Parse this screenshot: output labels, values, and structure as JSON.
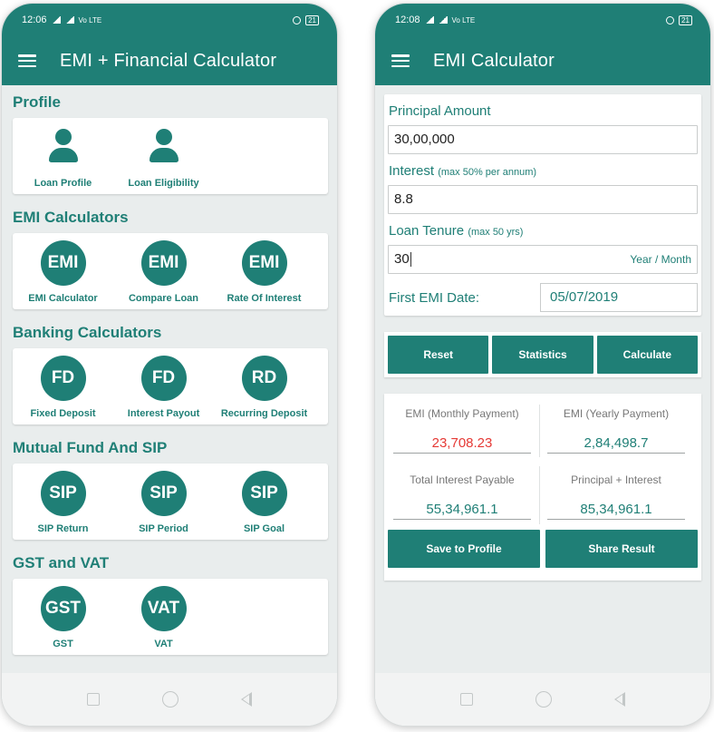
{
  "left": {
    "status": {
      "time": "12:06",
      "net": "Vo LTE",
      "battery": "21"
    },
    "title": "EMI + Financial Calculator",
    "sections": [
      {
        "title": "Profile",
        "items": [
          {
            "icon": "person-icon",
            "label": "Loan Profile"
          },
          {
            "icon": "person-icon",
            "label": "Loan Eligibility"
          }
        ]
      },
      {
        "title": "EMI Calculators",
        "items": [
          {
            "badge": "EMI",
            "label": "EMI Calculator"
          },
          {
            "badge": "EMI",
            "label": "Compare Loan"
          },
          {
            "badge": "EMI",
            "label": "Rate Of Interest"
          }
        ]
      },
      {
        "title": "Banking Calculators",
        "items": [
          {
            "badge": "FD",
            "label": "Fixed Deposit"
          },
          {
            "badge": "FD",
            "label": "Interest Payout"
          },
          {
            "badge": "RD",
            "label": "Recurring Deposit"
          }
        ]
      },
      {
        "title": "Mutual Fund And SIP",
        "items": [
          {
            "badge": "SIP",
            "label": "SIP Return"
          },
          {
            "badge": "SIP",
            "label": "SIP Period"
          },
          {
            "badge": "SIP",
            "label": "SIP Goal"
          }
        ]
      },
      {
        "title": "GST and VAT",
        "items": [
          {
            "badge": "GST",
            "label": "GST"
          },
          {
            "badge": "VAT",
            "label": "VAT"
          }
        ]
      }
    ]
  },
  "right": {
    "status": {
      "time": "12:08",
      "net": "Vo LTE",
      "battery": "21"
    },
    "title": "EMI Calculator",
    "principal": {
      "label": "Principal Amount",
      "value": "30,00,000"
    },
    "interest": {
      "label": "Interest",
      "hint": "(max 50% per annum)",
      "value": "8.8"
    },
    "tenure": {
      "label": "Loan Tenure",
      "hint": "(max 50 yrs)",
      "value": "30",
      "suffix": "Year / Month"
    },
    "first_emi": {
      "label": "First EMI Date:",
      "value": "05/07/2019"
    },
    "buttons": {
      "reset": "Reset",
      "statistics": "Statistics",
      "calculate": "Calculate"
    },
    "results": {
      "emi_monthly_label": "EMI (Monthly Payment)",
      "emi_monthly_value": "23,708.23",
      "emi_yearly_label": "EMI (Yearly Payment)",
      "emi_yearly_value": "2,84,498.7",
      "total_interest_label": "Total Interest Payable",
      "total_interest_value": "55,34,961.1",
      "principal_interest_label": "Principal + Interest",
      "principal_interest_value": "85,34,961.1"
    },
    "save_label": "Save to Profile",
    "share_label": "Share Result"
  },
  "colors": {
    "primary": "#1f7f76",
    "background": "#e9eded",
    "highlight": "#e53935"
  }
}
